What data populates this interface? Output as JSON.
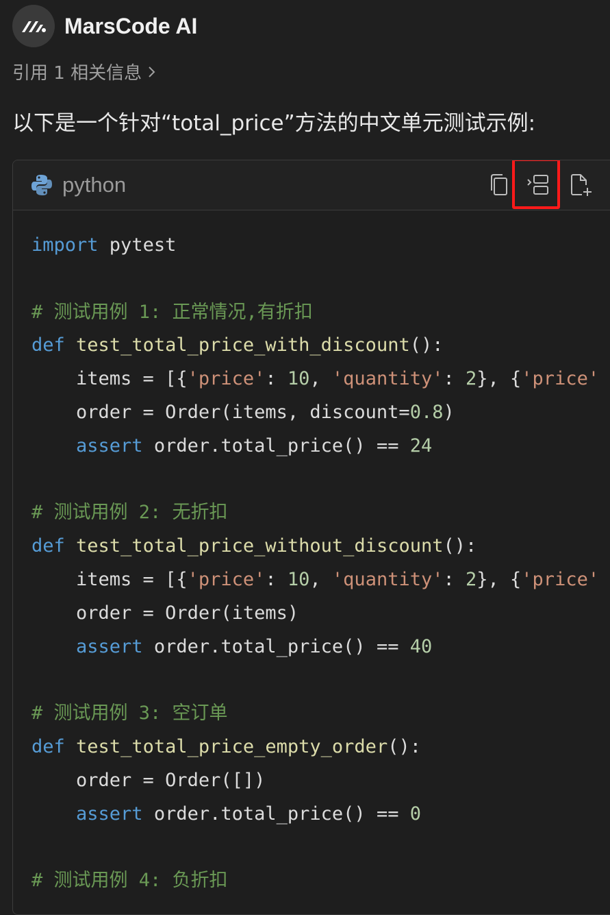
{
  "header": {
    "app_name": "MarsCode AI",
    "logo_icon": "marscode-logo-icon"
  },
  "references": {
    "label": "引用 1 相关信息",
    "chevron_icon": "chevron-right-icon"
  },
  "intro_text": "以下是一个针对“total_price”方法的中文单元测试示例:",
  "code_block": {
    "language": "python",
    "language_icon": "python-logo-icon",
    "toolbar": {
      "copy_icon": "copy-icon",
      "insert_icon": "insert-into-editor-icon",
      "new_file_icon": "new-file-icon"
    },
    "highlight_color": "#ff1a1a",
    "lines": [
      [
        {
          "t": "kw",
          "v": "import"
        },
        {
          "t": "id",
          "v": " pytest"
        }
      ],
      [],
      [
        {
          "t": "cm",
          "v": "# 测试用例 1: 正常情况,有折扣"
        }
      ],
      [
        {
          "t": "kw",
          "v": "def"
        },
        {
          "t": "id",
          "v": " "
        },
        {
          "t": "fn",
          "v": "test_total_price_with_discount"
        },
        {
          "t": "id",
          "v": "():"
        }
      ],
      [
        {
          "t": "id",
          "v": "    items = [{"
        },
        {
          "t": "str",
          "v": "'price'"
        },
        {
          "t": "id",
          "v": ": "
        },
        {
          "t": "num",
          "v": "10"
        },
        {
          "t": "id",
          "v": ", "
        },
        {
          "t": "str",
          "v": "'quantity'"
        },
        {
          "t": "id",
          "v": ": "
        },
        {
          "t": "num",
          "v": "2"
        },
        {
          "t": "id",
          "v": "}, {"
        },
        {
          "t": "str",
          "v": "'price'"
        }
      ],
      [
        {
          "t": "id",
          "v": "    order = Order(items, discount="
        },
        {
          "t": "num",
          "v": "0.8"
        },
        {
          "t": "id",
          "v": ")"
        }
      ],
      [
        {
          "t": "id",
          "v": "    "
        },
        {
          "t": "kw",
          "v": "assert"
        },
        {
          "t": "id",
          "v": " order.total_price() == "
        },
        {
          "t": "num",
          "v": "24"
        }
      ],
      [],
      [
        {
          "t": "cm",
          "v": "# 测试用例 2: 无折扣"
        }
      ],
      [
        {
          "t": "kw",
          "v": "def"
        },
        {
          "t": "id",
          "v": " "
        },
        {
          "t": "fn",
          "v": "test_total_price_without_discount"
        },
        {
          "t": "id",
          "v": "():"
        }
      ],
      [
        {
          "t": "id",
          "v": "    items = [{"
        },
        {
          "t": "str",
          "v": "'price'"
        },
        {
          "t": "id",
          "v": ": "
        },
        {
          "t": "num",
          "v": "10"
        },
        {
          "t": "id",
          "v": ", "
        },
        {
          "t": "str",
          "v": "'quantity'"
        },
        {
          "t": "id",
          "v": ": "
        },
        {
          "t": "num",
          "v": "2"
        },
        {
          "t": "id",
          "v": "}, {"
        },
        {
          "t": "str",
          "v": "'price'"
        }
      ],
      [
        {
          "t": "id",
          "v": "    order = Order(items)"
        }
      ],
      [
        {
          "t": "id",
          "v": "    "
        },
        {
          "t": "kw",
          "v": "assert"
        },
        {
          "t": "id",
          "v": " order.total_price() == "
        },
        {
          "t": "num",
          "v": "40"
        }
      ],
      [],
      [
        {
          "t": "cm",
          "v": "# 测试用例 3: 空订单"
        }
      ],
      [
        {
          "t": "kw",
          "v": "def"
        },
        {
          "t": "id",
          "v": " "
        },
        {
          "t": "fn",
          "v": "test_total_price_empty_order"
        },
        {
          "t": "id",
          "v": "():"
        }
      ],
      [
        {
          "t": "id",
          "v": "    order = Order([])"
        }
      ],
      [
        {
          "t": "id",
          "v": "    "
        },
        {
          "t": "kw",
          "v": "assert"
        },
        {
          "t": "id",
          "v": " order.total_price() == "
        },
        {
          "t": "num",
          "v": "0"
        }
      ],
      [],
      [
        {
          "t": "cm",
          "v": "# 测试用例 4: 负折扣"
        }
      ]
    ]
  }
}
